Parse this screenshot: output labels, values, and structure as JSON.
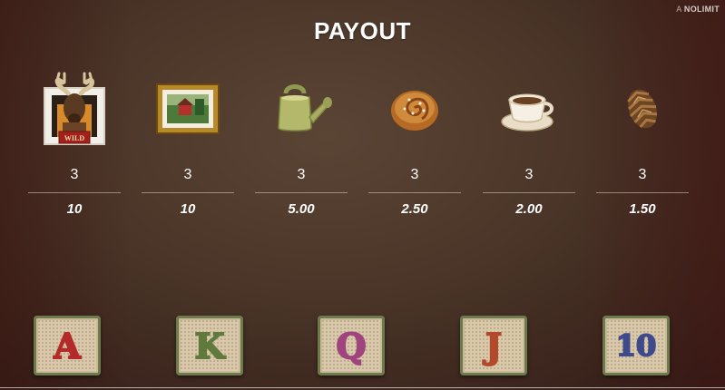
{
  "brand": {
    "prefix": "A",
    "name": "NOLIMIT"
  },
  "title": "PAYOUT",
  "symbols": [
    {
      "icon": "moose-wild-icon",
      "wild_label": "WILD",
      "count": "3",
      "payout": "10"
    },
    {
      "icon": "framed-picture-icon",
      "count": "3",
      "payout": "10"
    },
    {
      "icon": "watering-can-icon",
      "count": "3",
      "payout": "5.00"
    },
    {
      "icon": "cinnamon-bun-icon",
      "count": "3",
      "payout": "2.50"
    },
    {
      "icon": "coffee-cup-icon",
      "count": "3",
      "payout": "2.00"
    },
    {
      "icon": "pine-cone-icon",
      "count": "3",
      "payout": "1.50"
    }
  ],
  "tiles": [
    {
      "label": "A",
      "color": "#b32a2a"
    },
    {
      "label": "K",
      "color": "#5f7a3c"
    },
    {
      "label": "Q",
      "color": "#a0447e"
    },
    {
      "label": "J",
      "color": "#b1492a"
    },
    {
      "label": "10",
      "color": "#3e4a8c"
    }
  ]
}
